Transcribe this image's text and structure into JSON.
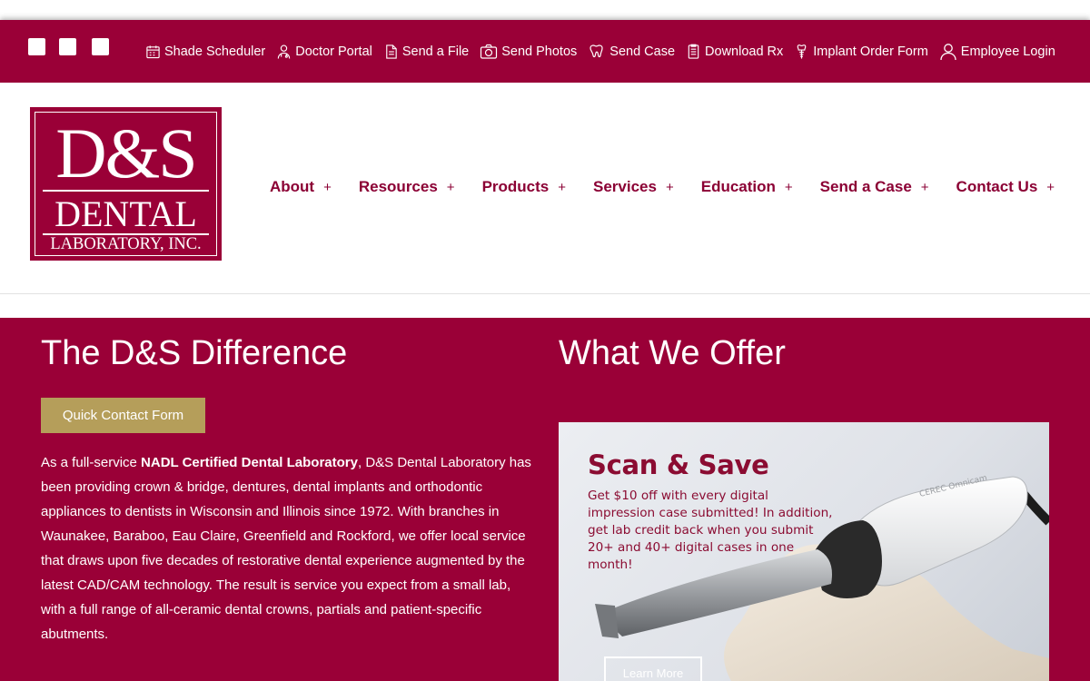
{
  "colors": {
    "brand": "#9a0037",
    "nav_text": "#8b0034",
    "button_gold": "#b59e5a",
    "white": "#ffffff"
  },
  "social_icons": [
    "facebook-icon",
    "twitter-icon",
    "linkedin-icon"
  ],
  "utility_nav": [
    {
      "label": "Shade Scheduler",
      "icon": "calendar-icon"
    },
    {
      "label": "Doctor Portal",
      "icon": "doctor-icon"
    },
    {
      "label": "Send a File",
      "icon": "file-icon"
    },
    {
      "label": "Send Photos",
      "icon": "camera-icon"
    },
    {
      "label": "Send Case",
      "icon": "tooth-icon"
    },
    {
      "label": "Download Rx",
      "icon": "document-icon"
    },
    {
      "label": "Implant Order Form",
      "icon": "implant-icon"
    },
    {
      "label": "Employee Login",
      "icon": "user-icon"
    }
  ],
  "logo": {
    "line1": "D&S",
    "line2": "DENTAL",
    "line3": "LABORATORY, INC."
  },
  "main_nav": [
    {
      "label": "About",
      "expand": "+"
    },
    {
      "label": "Resources",
      "expand": "+"
    },
    {
      "label": "Products",
      "expand": "+"
    },
    {
      "label": "Services",
      "expand": "+"
    },
    {
      "label": "Education",
      "expand": "+"
    },
    {
      "label": "Send a Case",
      "expand": "+"
    },
    {
      "label": "Contact Us",
      "expand": "+"
    }
  ],
  "left_section": {
    "title": "The D&S Difference",
    "button": "Quick Contact Form",
    "para_intro": "As a full-service ",
    "para_bold": "NADL Certified Dental Laboratory",
    "para_rest": ", D&S Dental Laboratory has been providing crown & bridge, dentures, dental implants and orthodontic appliances to dentists in Wisconsin and Illinois since 1972. With branches in Waunakee, Baraboo, Eau Claire, Greenfield and Rockford, we offer local service that draws upon five decades of restorative dental experience augmented by the latest CAD/CAM technology. The result is service you expect from a small lab, with a full range of all-ceramic dental crowns, partials and patient-specific abutments."
  },
  "right_section": {
    "title": "What We Offer",
    "promo": {
      "title": "Scan & Save",
      "text": "Get $10 off with every digital impression case submitted! In addition, get lab credit back when you submit 20+ and 40+ digital cases in one month!",
      "device_label": "CEREC Omnicam",
      "button": "Learn More"
    }
  }
}
